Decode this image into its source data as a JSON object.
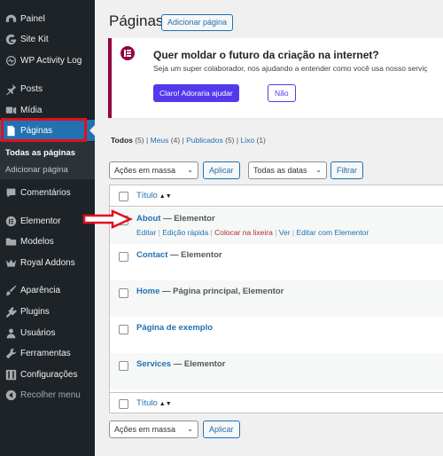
{
  "sidebar": {
    "items": [
      {
        "label": "Painel",
        "icon": "dashboard-icon"
      },
      {
        "label": "Site Kit",
        "icon": "site-kit-icon"
      },
      {
        "label": "WP Activity Log",
        "icon": "activity-log-icon"
      },
      {
        "label": "Posts",
        "icon": "pin-icon"
      },
      {
        "label": "Mídia",
        "icon": "media-icon"
      },
      {
        "label": "Páginas",
        "icon": "pages-icon"
      },
      {
        "label": "Comentários",
        "icon": "comment-icon"
      },
      {
        "label": "Elementor",
        "icon": "elementor-icon"
      },
      {
        "label": "Modelos",
        "icon": "folder-icon"
      },
      {
        "label": "Royal Addons",
        "icon": "crown-icon"
      },
      {
        "label": "Aparência",
        "icon": "brush-icon"
      },
      {
        "label": "Plugins",
        "icon": "plugin-icon"
      },
      {
        "label": "Usuários",
        "icon": "user-icon"
      },
      {
        "label": "Ferramentas",
        "icon": "wrench-icon"
      },
      {
        "label": "Configurações",
        "icon": "settings-icon"
      },
      {
        "label": "Recolher menu",
        "icon": "collapse-icon"
      }
    ],
    "submenu": [
      "Todas as páginas",
      "Adicionar página"
    ]
  },
  "header": {
    "title": "Páginas",
    "add_button": "Adicionar página"
  },
  "notice": {
    "title": "Quer moldar o futuro da criação na internet?",
    "text": "Seja um super colaborador, nos ajudando a entender como você usa nosso serviç",
    "primary_button": "Claro! Adoraria ajudar",
    "secondary_button": "Não",
    "accent_color": "#93003f"
  },
  "filters": {
    "all": "Todos",
    "all_count": "(5)",
    "mine": "Meus",
    "mine_count": "(4)",
    "published": "Publicados",
    "published_count": "(5)",
    "trash": "Lixo",
    "trash_count": "(1)",
    "sep": "|"
  },
  "bulk": {
    "select": "Ações em massa",
    "apply": "Aplicar",
    "dates": "Todas as datas",
    "filter": "Filtrar"
  },
  "table": {
    "column_title": "Título",
    "rows": [
      {
        "title": "About",
        "state": "— Elementor"
      },
      {
        "title": "Contact",
        "state": "— Elementor"
      },
      {
        "title": "Home",
        "state": "— Página principal, Elementor"
      },
      {
        "title": "Página de exemplo",
        "state": ""
      },
      {
        "title": "Services",
        "state": "— Elementor"
      }
    ],
    "row_actions": {
      "edit": "Editar",
      "quick_edit": "Edição rápida",
      "trash": "Colocar na lixeira",
      "view": "Ver",
      "elementor": "Editar com Elementor",
      "sep": "|"
    }
  },
  "colors": {
    "sidebar_bg": "#1d2327",
    "active_bg": "#2271b1",
    "annotation_red": "#e10f1e",
    "link": "#2271b1",
    "notice_button": "#5239ed"
  }
}
